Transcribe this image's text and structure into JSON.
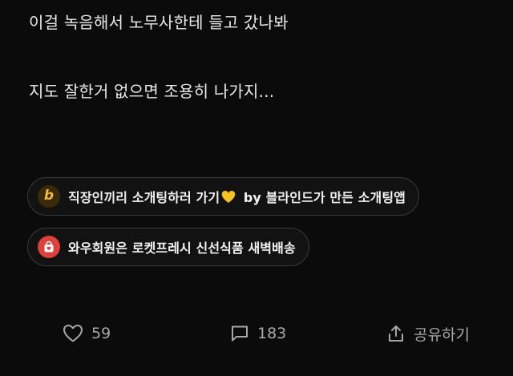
{
  "post": {
    "line1": "이걸 녹음해서 노무사한테 들고 갔나봐",
    "line2": "지도 잘한거 없으면 조용히 나가지..."
  },
  "ads": [
    {
      "icon": "blind-b-logo-icon",
      "label_before_emoji": "직장인끼리 소개팅하러 가기",
      "emoji": "yellow-heart-emoji",
      "label_after_emoji": " by 블라인드가 만든 소개팅앱"
    },
    {
      "icon": "shopping-bag-icon",
      "label": "와우회원은 로켓프레시 신선식품 새벽배송"
    }
  ],
  "actions": {
    "like_count": "59",
    "comment_count": "183",
    "share_label": "공유하기"
  },
  "colors": {
    "background": "#0b0b0b",
    "text": "#e9e9e9",
    "muted": "#a8a8a8",
    "chip_border": "#3a3a3a",
    "brand_b": "#f2b93a",
    "bag_red": "#e0403a"
  }
}
